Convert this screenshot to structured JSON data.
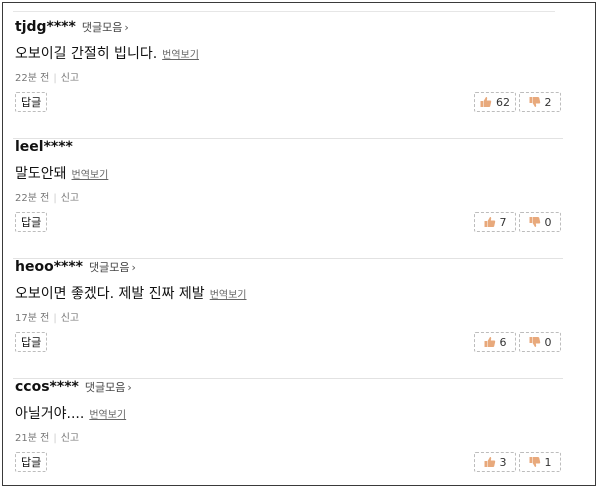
{
  "comments": [
    {
      "author": "tjdg****",
      "collect_label": "댓글모음",
      "text": "오보이길 간절히 빕니다.",
      "translate_label": "번역보기",
      "time": "22분 전",
      "report_label": "신고",
      "reply_label": "답글",
      "likes": "62",
      "dislikes": "2"
    },
    {
      "author": "leel****",
      "collect_label": "",
      "text": "말도안돼",
      "translate_label": "번역보기",
      "time": "22분 전",
      "report_label": "신고",
      "reply_label": "답글",
      "likes": "7",
      "dislikes": "0"
    },
    {
      "author": "heoo****",
      "collect_label": "댓글모음",
      "text": "오보이면 좋겠다. 제발 진짜 제발",
      "translate_label": "번역보기",
      "time": "17분 전",
      "report_label": "신고",
      "reply_label": "답글",
      "likes": "6",
      "dislikes": "0"
    },
    {
      "author": "ccos****",
      "collect_label": "댓글모음",
      "text": "아닐거야....",
      "translate_label": "번역보기",
      "time": "21분 전",
      "report_label": "신고",
      "reply_label": "답글",
      "likes": "3",
      "dislikes": "1"
    }
  ],
  "icons": {
    "collect_chevron": "chevron-right-icon",
    "like": "thumbs-up-icon",
    "dislike": "thumbs-down-icon"
  },
  "colors": {
    "thumb_up": "#e8a97c",
    "thumb_down": "#e8a97c"
  }
}
